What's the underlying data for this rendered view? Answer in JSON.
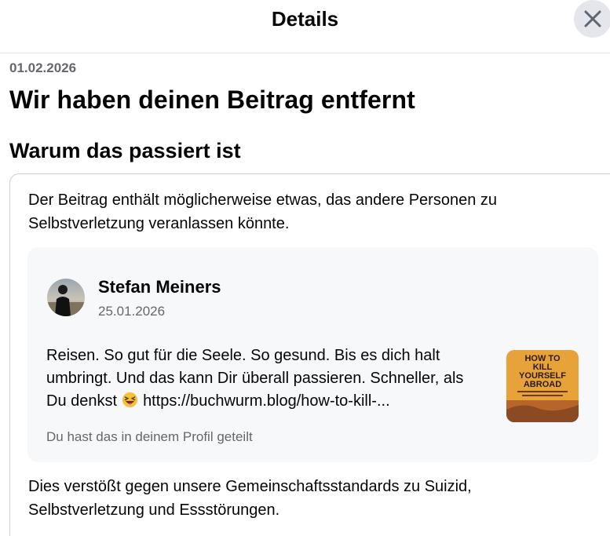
{
  "header": {
    "title": "Details"
  },
  "notice": {
    "date": "01.02.2026",
    "title": "Wir haben deinen Beitrag entfernt",
    "reason_heading": "Warum das passiert ist",
    "reason_text": "Der Beitrag enthält möglicherweise etwas, das andere Personen zu Selbstverletzung veranlassen könnte.",
    "violation_text": "Dies verstößt gegen unsere Gemeinschaftsstandards zu Suizid, Selbstverletzung und Essstörungen."
  },
  "post": {
    "author": "Stefan Meiners",
    "date": "25.01.2026",
    "text_before_emoji": "Reisen. So gut für die Seele. So gesund. Bis es dich halt umbringt. Und das kann Dir überall passieren. Schneller, als Du denkst",
    "text_after_emoji": "https://buchwurm.blog/how-to-kill-...",
    "emoji": "grinning-squinting-face",
    "shared_note": "Du hast das in deinem Profil geteilt",
    "thumbnail": {
      "line1": "HOW TO",
      "line2": "KILL",
      "line3": "YOURSELF",
      "line4": "ABROAD"
    }
  },
  "colors": {
    "secondary_text": "#65676b",
    "post_background": "#f7f8fa",
    "close_button_bg": "#e4e6eb",
    "thumbnail_bg": "#e8a23a"
  }
}
